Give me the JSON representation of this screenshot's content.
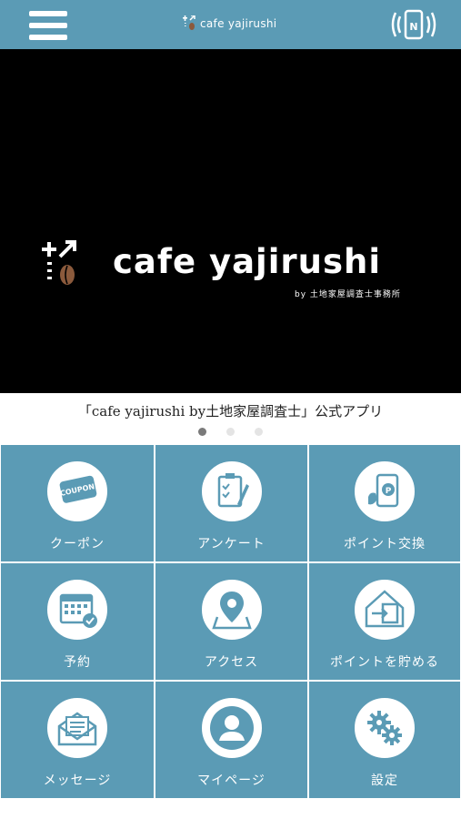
{
  "header": {
    "menu_icon": "hamburger-menu-icon",
    "brand": "cafe yajirushi",
    "nfc_icon": "nfc-phone-icon"
  },
  "hero": {
    "brand": "cafe yajirushi",
    "subtitle": "by 土地家屋調査士事務所"
  },
  "caption": "「cafe yajirushi by土地家屋調査士」公式アプリ",
  "carousel": {
    "dots": 3,
    "active": 0
  },
  "menu": [
    {
      "label": "クーポン",
      "icon": "coupon-icon"
    },
    {
      "label": "アンケート",
      "icon": "survey-icon"
    },
    {
      "label": "ポイント交換",
      "icon": "point-exchange-icon"
    },
    {
      "label": "予約",
      "icon": "calendar-icon"
    },
    {
      "label": "アクセス",
      "icon": "map-pin-icon"
    },
    {
      "label": "ポイントを貯める",
      "icon": "point-save-icon"
    },
    {
      "label": "メッセージ",
      "icon": "message-icon"
    },
    {
      "label": "マイページ",
      "icon": "user-icon"
    },
    {
      "label": "設定",
      "icon": "gear-icon"
    }
  ],
  "colors": {
    "accent": "#5b9bb5",
    "hero_bg": "#000000"
  }
}
